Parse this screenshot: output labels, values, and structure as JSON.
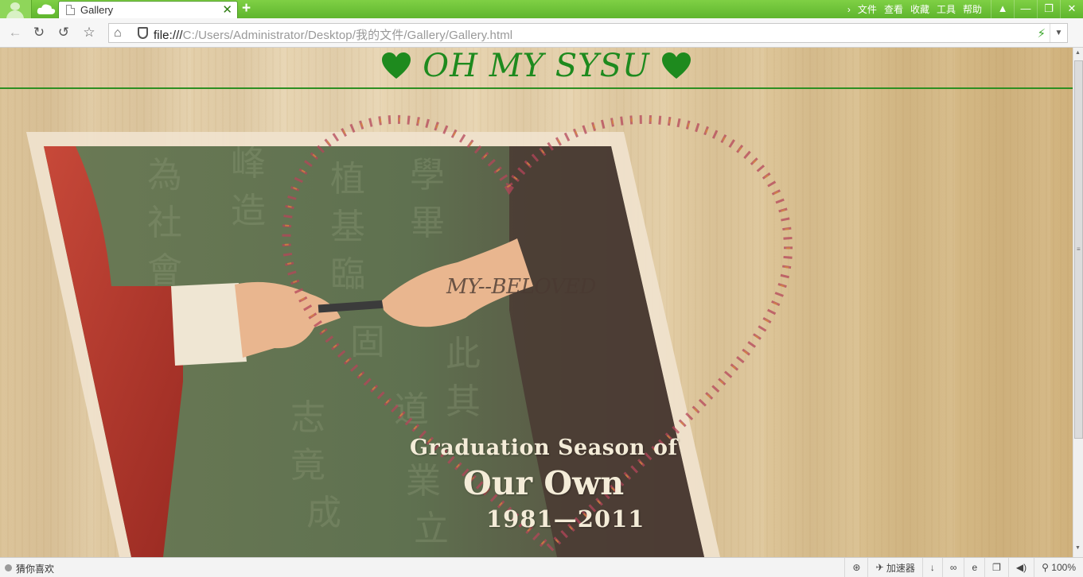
{
  "browser": {
    "tab": {
      "title": "Gallery",
      "close_icon": "close-icon"
    },
    "top_menu": [
      "文件",
      "查看",
      "收藏",
      "工具",
      "帮助"
    ],
    "window_controls": [
      "shirt-icon",
      "minimize-icon",
      "restore-icon",
      "close-icon"
    ],
    "address": {
      "protocol": "file:///",
      "path": "C:/Users/Administrator/Desktop/我的文件/Gallery/Gallery.html"
    },
    "status": {
      "left_text": "猜你喜欢",
      "accelerator": "加速器",
      "zoom": "100%"
    }
  },
  "page": {
    "title": "OH MY SYSU",
    "heart_color": "#1e8a1e",
    "photo_caption": "MY--BELOVED",
    "graduation": {
      "line1": "Graduation Season of",
      "line2": "Our Own",
      "line3": "1981—2011"
    }
  }
}
